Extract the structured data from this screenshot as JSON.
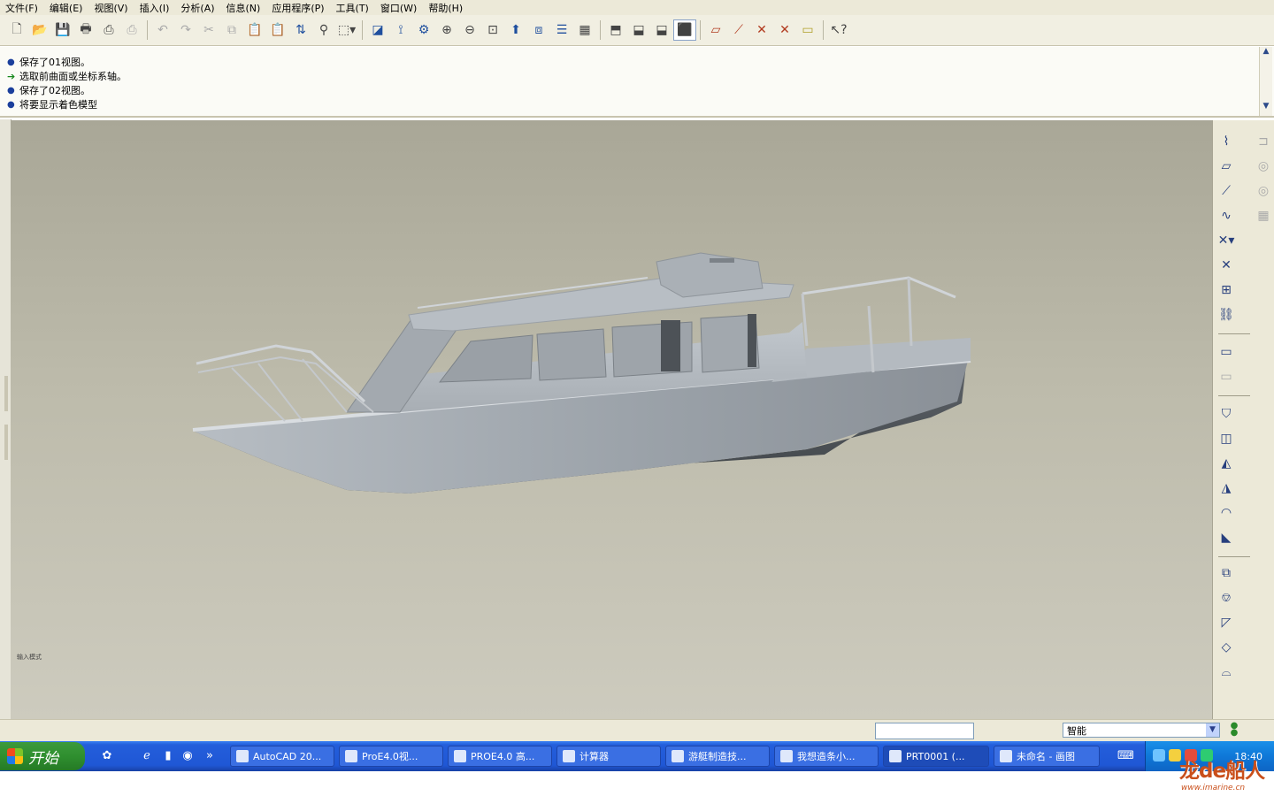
{
  "menu": [
    "文件(F)",
    "编辑(E)",
    "视图(V)",
    "插入(I)",
    "分析(A)",
    "信息(N)",
    "应用程序(P)",
    "工具(T)",
    "窗口(W)",
    "帮助(H)"
  ],
  "messages": [
    {
      "kind": "info",
      "text": "保存了01视图。"
    },
    {
      "kind": "prompt",
      "text": "选取前曲面或坐标系轴。"
    },
    {
      "kind": "info",
      "text": "保存了02视图。"
    },
    {
      "kind": "info",
      "text": "将要显示着色模型"
    }
  ],
  "viewport": {
    "small_text": "输入模式",
    "model": "boat-hull-3d-model"
  },
  "status": {
    "command_input": "",
    "filter_value": "智能"
  },
  "taskbar": {
    "start_label": "开始",
    "tasks": [
      {
        "label": "AutoCAD 20...",
        "active": false
      },
      {
        "label": "ProE4.0视...",
        "active": false
      },
      {
        "label": "PROE4.0 高...",
        "active": false
      },
      {
        "label": "计算器",
        "active": false
      },
      {
        "label": "游艇制造技...",
        "active": false
      },
      {
        "label": "我想造条小...",
        "active": false
      },
      {
        "label": "PRT0001 (...",
        "active": true
      },
      {
        "label": "未命名 - 画图",
        "active": false
      }
    ],
    "clock": "18:40"
  },
  "watermark": {
    "brand": "龙de船人",
    "url": "www.imarine.cn"
  }
}
